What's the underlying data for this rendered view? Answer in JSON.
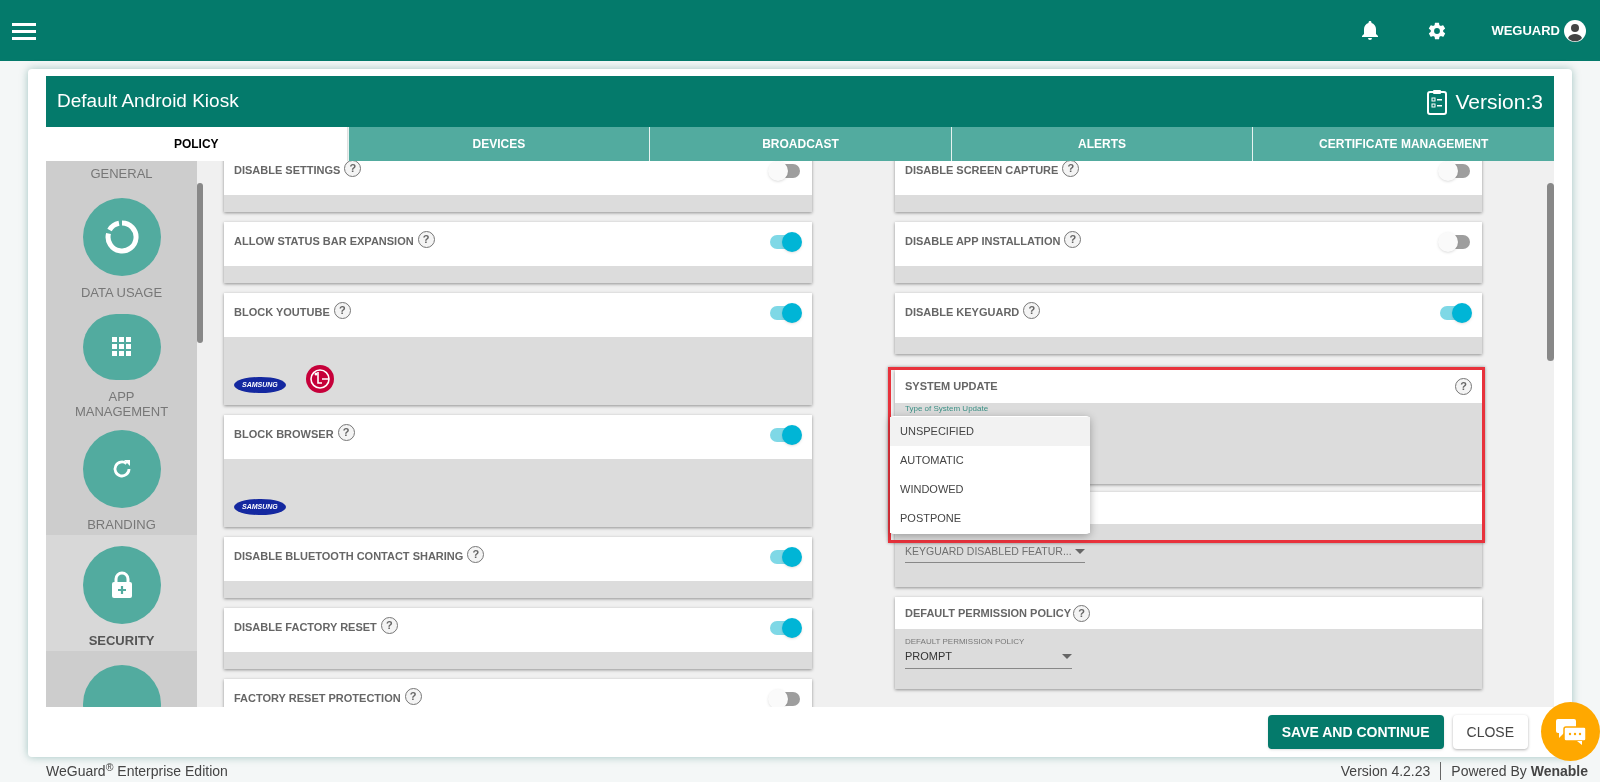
{
  "top_bar": {
    "user": "WEGUARD"
  },
  "panel": {
    "title": "Default Android Kiosk",
    "version": "Version:3",
    "tabs": [
      {
        "label": "POLICY",
        "selected": true
      },
      {
        "label": "DEVICES",
        "selected": false
      },
      {
        "label": "BROADCAST",
        "selected": false
      },
      {
        "label": "ALERTS",
        "selected": false
      },
      {
        "label": "CERTIFICATE MANAGEMENT",
        "selected": false
      }
    ],
    "sidebar": [
      {
        "label": "GENERAL",
        "kind": "none",
        "selected": false
      },
      {
        "label": "DATA USAGE",
        "kind": "ring",
        "selected": false
      },
      {
        "label": "APP MANAGEMENT",
        "kind": "grid",
        "selected": false
      },
      {
        "label": "BRANDING",
        "kind": "refresh",
        "selected": false
      },
      {
        "label": "SECURITY",
        "kind": "lock",
        "selected": true
      }
    ],
    "left_cards": [
      {
        "title": "DISABLE SETTINGS",
        "help": "?",
        "on": false
      },
      {
        "title": "ALLOW STATUS BAR EXPANSION",
        "help": "?",
        "on": true
      },
      {
        "title": "BLOCK YOUTUBE",
        "help": "?",
        "on": true,
        "logos": [
          {
            "kind": "samsung",
            "text": "SAMSUNG"
          },
          {
            "kind": "lg"
          }
        ]
      },
      {
        "title": "BLOCK BROWSER",
        "help": "?",
        "on": true,
        "logos": [
          {
            "kind": "samsung",
            "text": "SAMSUNG"
          }
        ]
      },
      {
        "title": "DISABLE BLUETOOTH CONTACT SHARING",
        "help": "?",
        "on": true
      },
      {
        "title": "DISABLE FACTORY RESET",
        "help": "?",
        "on": true
      },
      {
        "title": "FACTORY RESET PROTECTION",
        "help": "?",
        "on": false
      }
    ],
    "right_cards": [
      {
        "title": "DISABLE SCREEN CAPTURE",
        "help": "?",
        "on": false
      },
      {
        "title": "DISABLE APP INSTALLATION",
        "help": "?",
        "on": false
      },
      {
        "title": "DISABLE KEYGUARD",
        "help": "?",
        "on": true
      }
    ],
    "system_update": {
      "title": "SYSTEM UPDATE",
      "help": "?",
      "field_label": "Type of System Update",
      "options": [
        {
          "label": "UNSPECIFIED",
          "selected": true
        },
        {
          "label": "AUTOMATIC",
          "selected": false
        },
        {
          "label": "WINDOWED",
          "selected": false
        },
        {
          "label": "POSTPONE",
          "selected": false
        }
      ]
    },
    "keyguard_features": {
      "placeholder": "KEYGUARD DISABLED FEATUR..."
    },
    "permission_policy": {
      "title": "DEFAULT PERMISSION POLICY",
      "help": "?",
      "field_label": "DEFAULT PERMISSION POLICY",
      "value": "PROMPT"
    },
    "buttons": [
      {
        "label": "SAVE AND CONTINUE",
        "kind": "primary"
      },
      {
        "label": "CLOSE",
        "kind": "secondary"
      }
    ]
  },
  "footer": {
    "edition": "WeGuard$^{®}$ Enterprise Edition",
    "version": "Version 4.2.23",
    "powered": "Powered By **Wenable**"
  }
}
